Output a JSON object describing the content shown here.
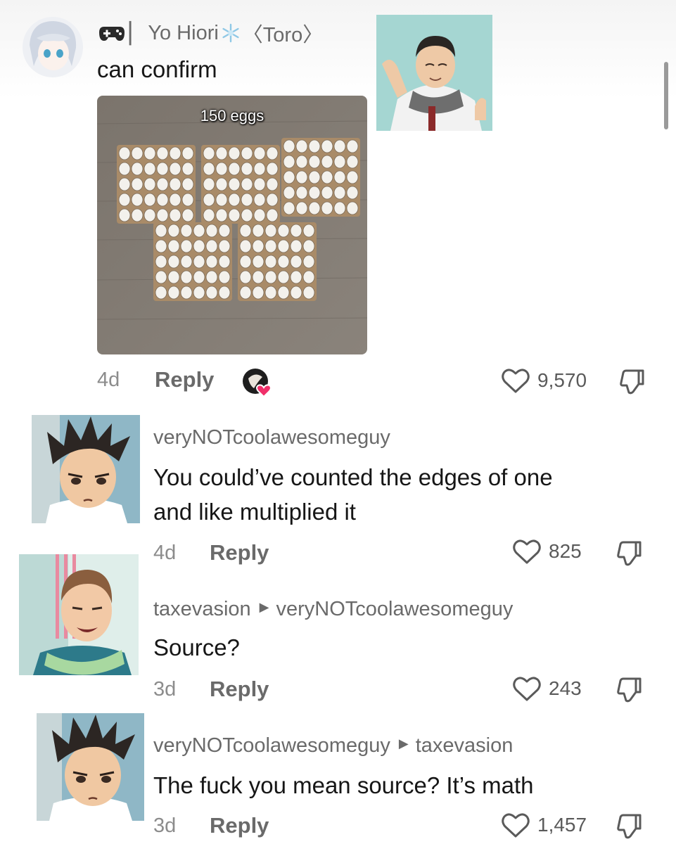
{
  "top_comment": {
    "user_prefix": "▏",
    "username": "Yo Hiori",
    "flair": "〈Toro〉",
    "text": "can confirm",
    "image_caption": "150 eggs",
    "time": "4d",
    "reply_label": "Reply",
    "likes": "9,570"
  },
  "comments": [
    {
      "username": "veryNOTcoolawesomeguy",
      "reply_to": "",
      "text_line1": "You could’ve counted the edges of one",
      "text_line2": "and like multiplied it",
      "time": "4d",
      "reply_label": "Reply",
      "likes": "825"
    },
    {
      "username": "taxevasion",
      "reply_to": "veryNOTcoolawesomeguy",
      "text_line1": "Source?",
      "time": "3d",
      "reply_label": "Reply",
      "likes": "243"
    },
    {
      "username": "veryNOTcoolawesomeguy",
      "reply_to": "taxevasion",
      "text_line1": "The fuck you mean source? It’s math",
      "time": "3d",
      "reply_label": "Reply",
      "likes": "1,457"
    }
  ],
  "icons": {
    "heart": "heart-outline-icon",
    "dislike": "thumbs-down-icon",
    "reply_arrow": "triangle-right-icon",
    "controller": "gamepad-icon",
    "flower": "snowflake-flower-icon"
  },
  "colors": {
    "text_primary": "#161616",
    "text_secondary": "#6a6a6a",
    "meta": "#8c8c8c",
    "liked_by_creator_heart": "#f0306a"
  }
}
